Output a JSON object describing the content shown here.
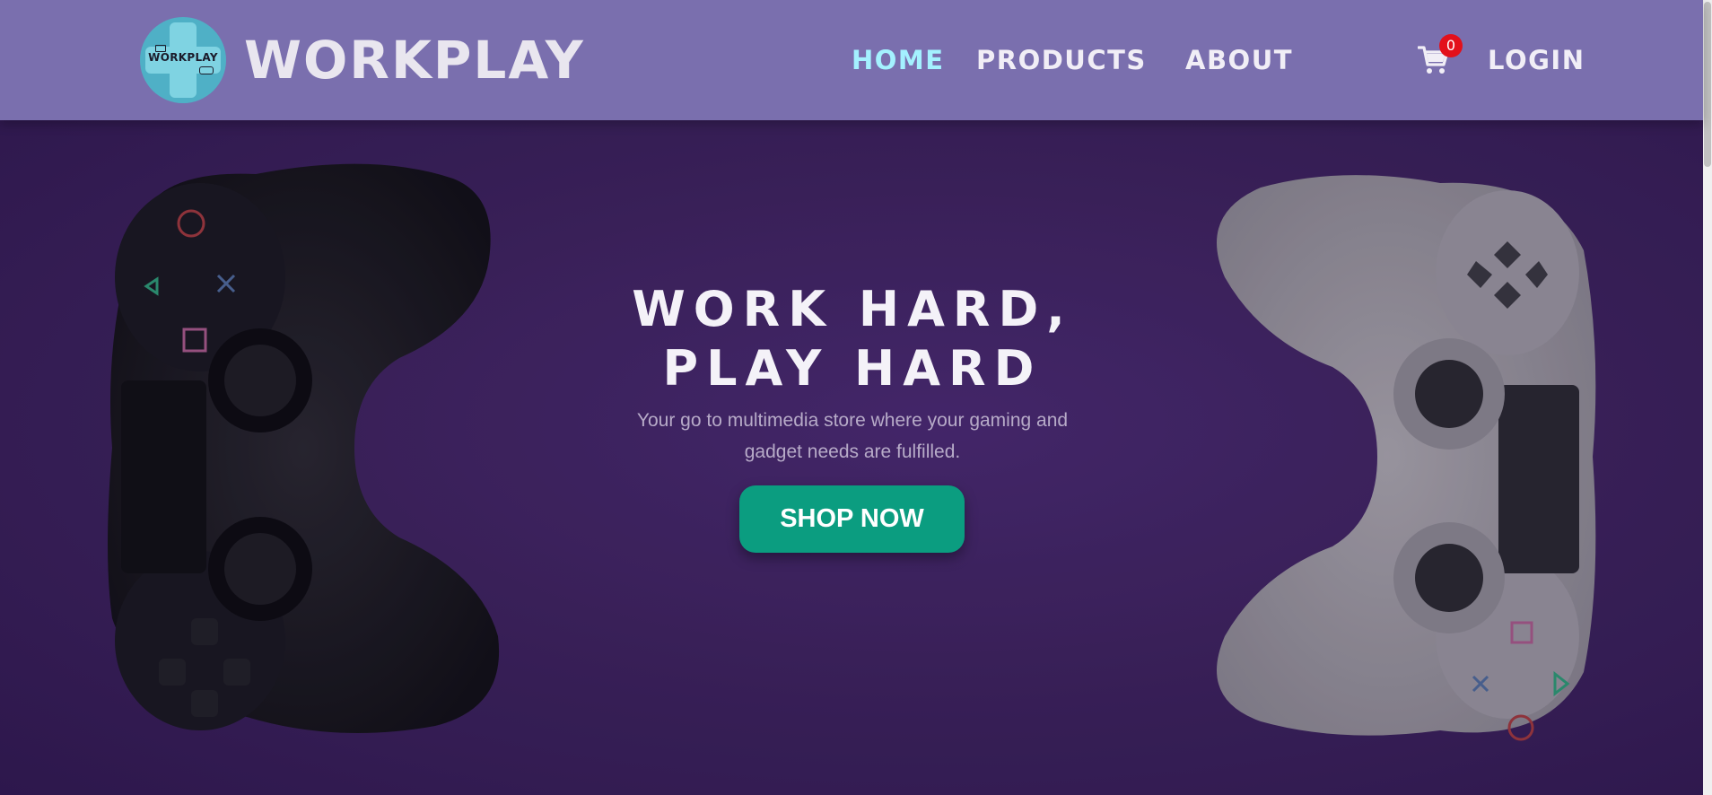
{
  "brand": {
    "name": "WORKPLAY",
    "badge_text": "WORKPLAY"
  },
  "nav": {
    "items": [
      {
        "label": "HOME",
        "active": true
      },
      {
        "label": "PRODUCTS",
        "active": false
      },
      {
        "label": "ABOUT",
        "active": false
      }
    ],
    "cart_icon": "shopping-cart-icon",
    "cart_count": "0",
    "login_label": "LOGIN"
  },
  "hero": {
    "title_line1": "WORK HARD,",
    "title_line2": "PLAY HARD",
    "subtitle": "Your go to multimedia store where your gaming and gadget needs are fulfilled.",
    "cta_label": "SHOP NOW"
  },
  "colors": {
    "header_bg": "#7a6fae",
    "hero_bg": "#3f245f",
    "active_nav": "#a4f1ff",
    "cta_bg": "#0b9d80",
    "cart_badge": "#e3101b"
  }
}
